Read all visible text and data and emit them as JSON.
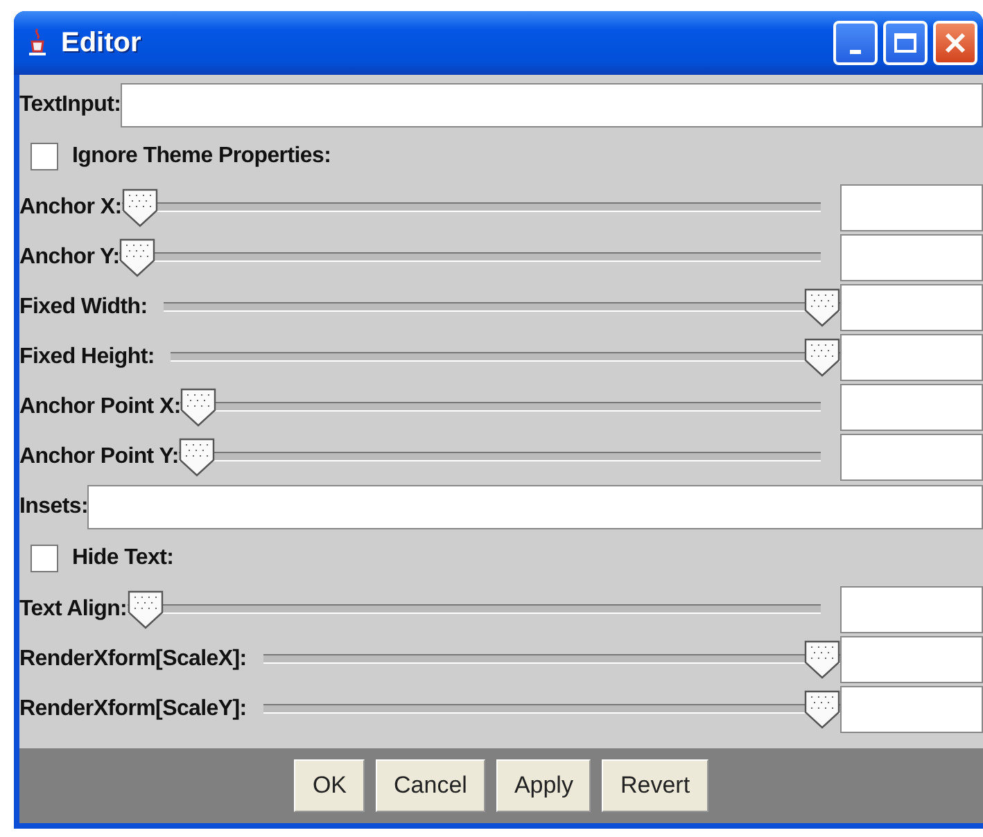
{
  "window": {
    "title": "Editor"
  },
  "rows": [
    {
      "kind": "text",
      "label": "TextInput:"
    },
    {
      "kind": "checkbox",
      "label": "Ignore Theme Properties:",
      "checked": false
    },
    {
      "kind": "slider",
      "label": "Anchor X:",
      "level": 0
    },
    {
      "kind": "slider",
      "label": "Anchor Y:",
      "level": 0
    },
    {
      "kind": "slider",
      "label": "Fixed Width:",
      "level": 1
    },
    {
      "kind": "slider",
      "label": "Fixed Height:",
      "level": 1
    },
    {
      "kind": "slider",
      "label": "Anchor Point X:",
      "level": 0
    },
    {
      "kind": "slider",
      "label": "Anchor Point Y:",
      "level": 0
    },
    {
      "kind": "text",
      "label": "Insets:"
    },
    {
      "kind": "checkbox",
      "label": "Hide Text:",
      "checked": false
    },
    {
      "kind": "slider",
      "label": "Text Align:",
      "level": 0
    },
    {
      "kind": "slider",
      "label": "RenderXform[ScaleX]:",
      "level": 1
    },
    {
      "kind": "slider",
      "label": "RenderXform[ScaleY]:",
      "level": 1
    }
  ],
  "buttons": [
    "OK",
    "Cancel",
    "Apply",
    "Revert"
  ]
}
